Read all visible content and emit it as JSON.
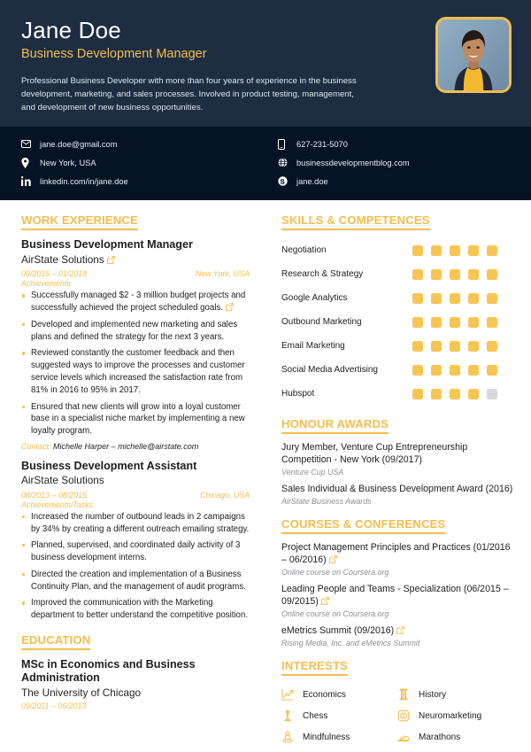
{
  "header": {
    "name": "Jane Doe",
    "job_title": "Business Development Manager",
    "summary": "Professional Business Developer with more than four years of experience in the business development, marketing, and sales processes. Involved in product testing, management, and development of new business opportunities.",
    "photo_alt": "portrait-photo",
    "accent_color": "#f3bd4d",
    "header_bg": "#1e2d42",
    "contact_bar_bg": "#061325"
  },
  "contacts": {
    "left": [
      {
        "icon": "email-icon",
        "value": "jane.doe@gmail.com"
      },
      {
        "icon": "location-pin-icon",
        "value": "New York, USA"
      },
      {
        "icon": "linkedin-icon",
        "value": "linkedin.com/in/jane.doe"
      }
    ],
    "right": [
      {
        "icon": "mobile-phone-icon",
        "value": "627-231-5070"
      },
      {
        "icon": "globe-icon",
        "value": "businessdevelopmentblog.com"
      },
      {
        "icon": "skype-icon",
        "value": "jane.doe"
      }
    ]
  },
  "work_experience": {
    "heading": "WORK EXPERIENCE",
    "jobs": [
      {
        "title": "Business Development Manager",
        "org": "AirState Solutions",
        "has_link": true,
        "dates": "09/2015 – 01/2018",
        "location": "New York, USA",
        "subheading": "Achievements",
        "bullets": [
          {
            "text": "Successfully managed $2 - 3 million budget projects and successfully achieved the project scheduled goals.",
            "has_link": true
          },
          {
            "text": "Developed and implemented new marketing and sales plans and defined the strategy for the next 3 years.",
            "has_link": false
          },
          {
            "text": "Reviewed constantly the customer feedback and then suggested ways to improve the processes and customer service levels which increased the satisfaction rate from 81% in 2016 to 95% in 2017.",
            "has_link": false
          },
          {
            "text": "Ensured that new clients will grow into a loyal customer base in a specialist niche market by implementing a new loyalty program.",
            "has_link": false
          }
        ],
        "contact_label": "Contact:",
        "contact_value": "Michelle Harper – michelle@airstate.com"
      },
      {
        "title": "Business Development Assistant",
        "org": "AirState Solutions",
        "has_link": false,
        "dates": "08/2013 – 08/2015",
        "location": "Chicago, USA",
        "subheading": "Achievements/Tasks",
        "bullets": [
          {
            "text": "Increased the number of outbound leads in 2 campaigns by 34% by creating a different outreach emailing strategy.",
            "has_link": false
          },
          {
            "text": "Planned, supervised, and coordinated daily activity of 3 business development interns.",
            "has_link": false
          },
          {
            "text": "Directed the creation and implementation of a Business Continuity Plan, and the management of audit programs.",
            "has_link": false
          },
          {
            "text": "Improved the communication with the Marketing department to better understand the competitive position.",
            "has_link": false
          }
        ],
        "contact_label": "",
        "contact_value": ""
      }
    ]
  },
  "education": {
    "heading": "EDUCATION",
    "entries": [
      {
        "degree": "MSc in Economics and Business Administration",
        "school": "The University of Chicago",
        "dates": "09/2011 – 06/2013"
      }
    ]
  },
  "skills": {
    "heading": "SKILLS & COMPETENCES",
    "max_level": 5,
    "items": [
      {
        "name": "Negotiation",
        "level": 5
      },
      {
        "name": "Research & Strategy",
        "level": 5
      },
      {
        "name": "Google Analytics",
        "level": 5
      },
      {
        "name": "Outbound Marketing",
        "level": 5
      },
      {
        "name": "Email Marketing",
        "level": 5
      },
      {
        "name": "Social Media Advertising",
        "level": 5
      },
      {
        "name": "Hubspot",
        "level": 4
      }
    ]
  },
  "awards": {
    "heading": "HONOUR AWARDS",
    "items": [
      {
        "title": "Jury Member, Venture Cup Entrepreneurship Competition - New York (09/2017)",
        "sub": "Venture Cup USA",
        "has_link": false
      },
      {
        "title": "Sales Individual & Business Development Award (2016)",
        "sub": "AirState Business Awards",
        "has_link": false
      }
    ]
  },
  "courses": {
    "heading": "COURSES & CONFERENCES",
    "items": [
      {
        "title": "Project Management Principles and Practices (01/2016 – 06/2016)",
        "sub": "Online course on Coursera.org",
        "has_link": true
      },
      {
        "title": "Leading People and Teams - Specialization (06/2015 – 09/2015)",
        "sub": "Online course on Coursera.org",
        "has_link": true
      },
      {
        "title": "eMetrics Summit (09/2016)",
        "sub": "Rising Media, Inc. and eMetrics Summit",
        "has_link": true
      }
    ]
  },
  "interests": {
    "heading": "INTERESTS",
    "items": [
      {
        "label": "Economics",
        "icon": "chart-line-icon"
      },
      {
        "label": "History",
        "icon": "column-pillar-icon"
      },
      {
        "label": "Chess",
        "icon": "chess-pawn-icon"
      },
      {
        "label": "Neuromarketing",
        "icon": "brain-icon"
      },
      {
        "label": "Mindfulness",
        "icon": "meditation-icon"
      },
      {
        "label": "Marathons",
        "icon": "running-shoe-icon"
      }
    ]
  }
}
